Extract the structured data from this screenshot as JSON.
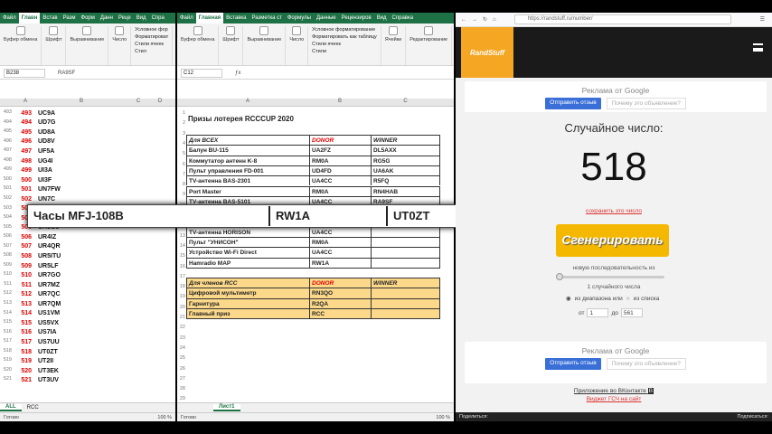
{
  "excel_left": {
    "menu_tabs": [
      "Файл",
      "Главн",
      "Встав",
      "Разм",
      "Форм",
      "Данн",
      "Реце",
      "Вид",
      "Спра"
    ],
    "active_tab": "Главн",
    "ribbon": {
      "buffer": "Буфер обмена",
      "font": "Шрифт",
      "align": "Выравнивание",
      "number": "Число",
      "cond": "Условное фор",
      "formatting": "Форматироват",
      "styles_cells": "Стили ячеек",
      "styles": "Стил"
    },
    "name_box": "B238",
    "formula": "RA9SF",
    "columns": [
      "A",
      "B",
      "C",
      "D"
    ],
    "rows": [
      {
        "row": "493",
        "n": "493",
        "call": "UC9A"
      },
      {
        "row": "494",
        "n": "494",
        "call": "UD7G"
      },
      {
        "row": "495",
        "n": "495",
        "call": "UD8A"
      },
      {
        "row": "496",
        "n": "496",
        "call": "UD8V"
      },
      {
        "row": "497",
        "n": "497",
        "call": "UF5A"
      },
      {
        "row": "498",
        "n": "498",
        "call": "UG4I"
      },
      {
        "row": "499",
        "n": "499",
        "call": "UI3A"
      },
      {
        "row": "500",
        "n": "500",
        "call": "UI3F"
      },
      {
        "row": "501",
        "n": "501",
        "call": "UN7FW"
      },
      {
        "row": "502",
        "n": "502",
        "call": "UN7C"
      },
      {
        "row": "503",
        "n": "503",
        "call": ""
      },
      {
        "row": "504",
        "n": "504",
        "call": ""
      },
      {
        "row": "505",
        "n": "505",
        "call": "UR3GJ"
      },
      {
        "row": "506",
        "n": "506",
        "call": "UR4IZ"
      },
      {
        "row": "507",
        "n": "507",
        "call": "UR4QR"
      },
      {
        "row": "508",
        "n": "508",
        "call": "UR5ITU"
      },
      {
        "row": "509",
        "n": "509",
        "call": "UR5LF"
      },
      {
        "row": "510",
        "n": "510",
        "call": "UR7GO"
      },
      {
        "row": "511",
        "n": "511",
        "call": "UR7MZ"
      },
      {
        "row": "512",
        "n": "512",
        "call": "UR7QC"
      },
      {
        "row": "513",
        "n": "513",
        "call": "UR7QM"
      },
      {
        "row": "514",
        "n": "514",
        "call": "US1VM"
      },
      {
        "row": "515",
        "n": "515",
        "call": "US5VX"
      },
      {
        "row": "516",
        "n": "516",
        "call": "US7IA"
      },
      {
        "row": "517",
        "n": "517",
        "call": "US7UU"
      },
      {
        "row": "518",
        "n": "518",
        "call": "UT0ZT"
      },
      {
        "row": "519",
        "n": "519",
        "call": "UT2II"
      },
      {
        "row": "520",
        "n": "520",
        "call": "UT3EK"
      },
      {
        "row": "521",
        "n": "521",
        "call": "UT3UV"
      }
    ],
    "sheet_tabs": [
      "ALL",
      "RCC"
    ],
    "active_sheet": "ALL",
    "status": "Готово",
    "zoom": "100 %"
  },
  "excel_right": {
    "menu_tabs": [
      "Файл",
      "Главная",
      "Вставка",
      "Разметка ст",
      "Формулы",
      "Данные",
      "Рецензиров",
      "Вид",
      "Справка"
    ],
    "active_tab": "Главная",
    "ribbon": {
      "buffer": "Буфер обмена",
      "font": "Шрифт",
      "align": "Выравнивание",
      "number": "Число",
      "cond": "Условное форматирование",
      "table": "Форматировать как таблицу",
      "styles_cells": "Стили ячеек",
      "cells": "Ячейки",
      "edit": "Редактирование",
      "styles": "Стили"
    },
    "name_box": "C12",
    "columns": [
      "A",
      "B",
      "C"
    ],
    "row_numbers": [
      "1",
      "2",
      "3",
      "4",
      "5",
      "6",
      "7",
      "8",
      "9",
      "10",
      "11",
      "12",
      "13",
      "14",
      "15",
      "16",
      "17",
      "18",
      "19",
      "20",
      "21",
      "22",
      "23",
      "24",
      "25",
      "26",
      "27",
      "28",
      "29",
      "30",
      "31",
      "32",
      "33"
    ],
    "title": "Призы лотерея RCCCUP 2020",
    "header1": {
      "a": "Для ВСЕХ",
      "b": "DONOR",
      "c": "WINNER"
    },
    "prizes": [
      {
        "a": "Балун BU-115",
        "b": "UA2FZ",
        "c": "DL5AXX"
      },
      {
        "a": "Коммутатор антенн K-8",
        "b": "RM0A",
        "c": "RG5G"
      },
      {
        "a": "Пульт управления FD-001",
        "b": "UD4FD",
        "c": "UA6AK"
      },
      {
        "a": "TV-антенна BAS-2301",
        "b": "UA4CC",
        "c": "R5FQ"
      },
      {
        "a": "Port Master",
        "b": "RM0A",
        "c": "RN4HAB"
      },
      {
        "a": "TV-антенна BAS-5101",
        "b": "UA4CC",
        "c": "RA9SF"
      },
      {
        "a": "",
        "b": "",
        "c": ""
      },
      {
        "a": "",
        "b": "",
        "c": ""
      },
      {
        "a": "TV-антенна HORISON",
        "b": "UA4CC",
        "c": ""
      },
      {
        "a": "Пульт \"УНИСОН\"",
        "b": "RM0A",
        "c": ""
      },
      {
        "a": "Устройство Wi-Fi Direct",
        "b": "UA4CC",
        "c": ""
      },
      {
        "a": "Hamradio MAP",
        "b": "RW1A",
        "c": ""
      }
    ],
    "header2": {
      "a": "Для членов RCC",
      "b": "DONOR",
      "c": "WINNER"
    },
    "rcc_prizes": [
      {
        "a": "Цифровой мультиметр",
        "b": "RN3QO",
        "c": ""
      },
      {
        "a": "Гарнитура",
        "b": "R2QA",
        "c": ""
      },
      {
        "a": "Главный приз",
        "b": "RCC",
        "c": ""
      }
    ],
    "sheet_tabs": [
      "Лист1"
    ],
    "status": "Готово",
    "zoom": "100 %"
  },
  "overlay": {
    "prize": "Часы MFJ-108B",
    "donor": "RW1A",
    "winner": "UT0ZT"
  },
  "browser": {
    "url": "https://randstuff.ru/number/",
    "logo": "RandStuff",
    "ad_title": "Реклама от Google",
    "ad_send": "Отправить отзыв",
    "ad_why": "Почему это объявление?",
    "random_label": "Случайное число:",
    "number": "518",
    "save_link": "сохранить это число",
    "generate": "Сгенерировать",
    "sequence_label": "новую последовательность из",
    "count_label": "1 случайного числа",
    "range_opt": "из диапазона или",
    "list_opt": "из списка",
    "from_label": "от",
    "from_value": "1",
    "to_label": "до",
    "to_value": "561",
    "vk_app": "Приложение во ВКонтакте",
    "widget": "Виджет ГСЧ на сайт",
    "share": "Поделиться:",
    "subscribe": "Подписаться:"
  }
}
